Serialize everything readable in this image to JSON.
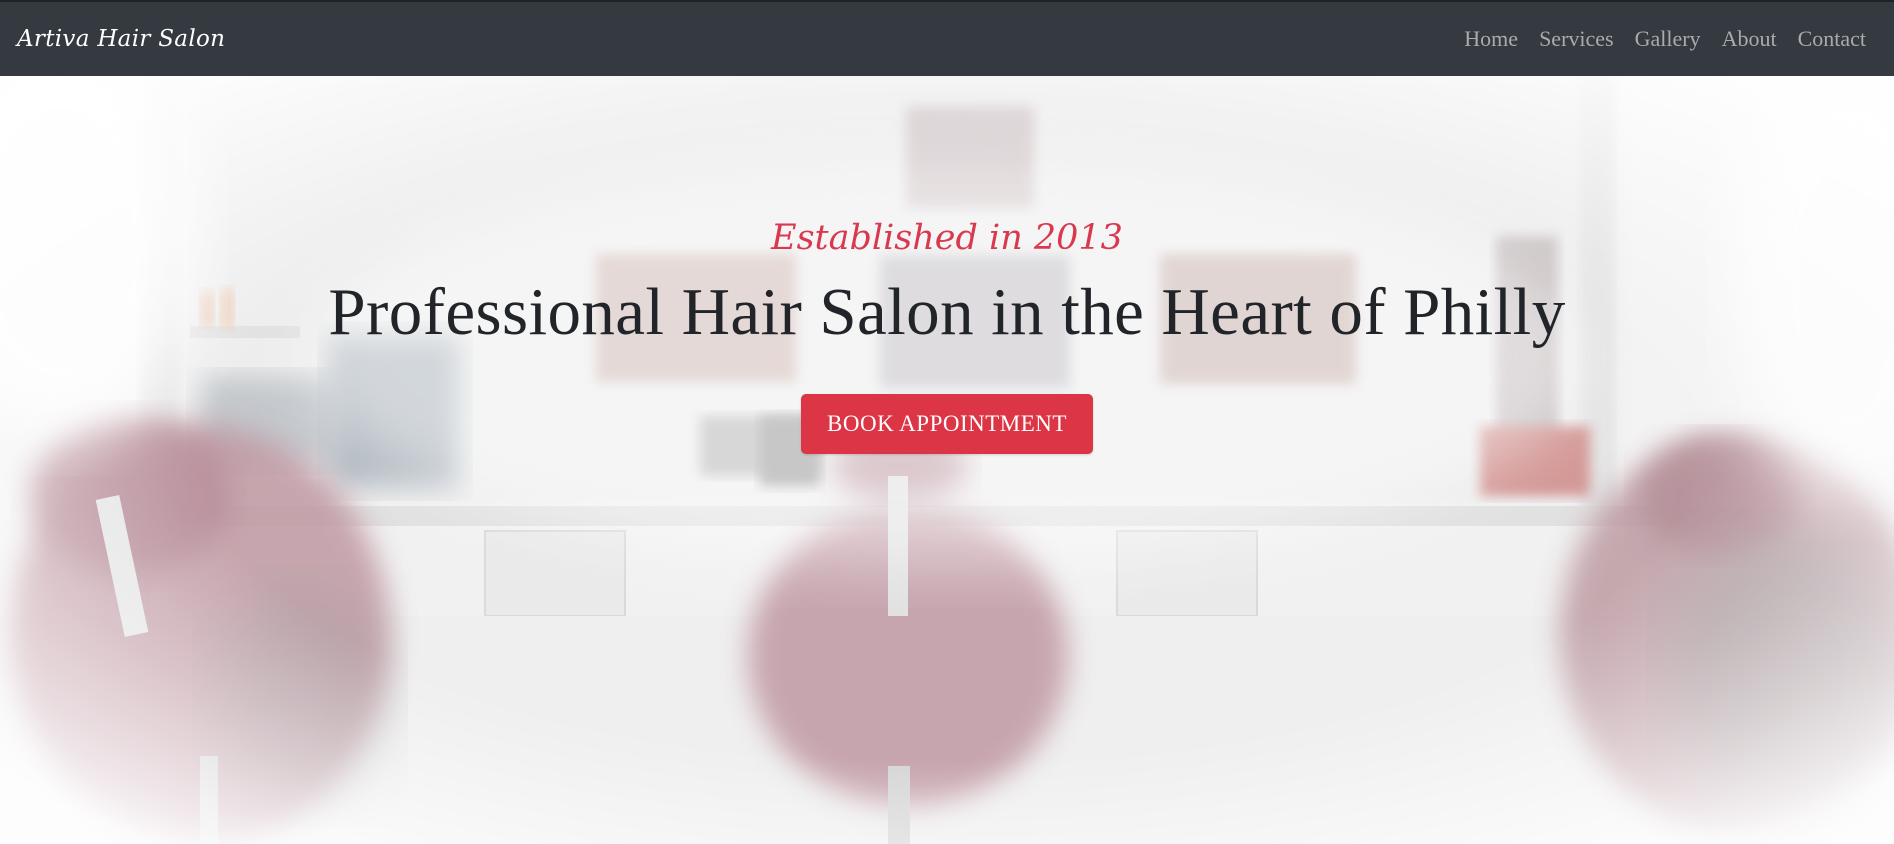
{
  "navbar": {
    "brand": "Artiva Hair Salon",
    "links": [
      "Home",
      "Services",
      "Gallery",
      "About",
      "Contact"
    ]
  },
  "hero": {
    "tagline": "Established in 2013",
    "headline": "Professional Hair Salon in the Heart of Philly",
    "cta_label": "BOOK APPOINTMENT"
  },
  "colors": {
    "navbar_bg": "#343a40",
    "accent": "#dc3545",
    "tagline": "#d9394f",
    "nav_link": "#a9abae",
    "chair": "#9a5a6a"
  }
}
